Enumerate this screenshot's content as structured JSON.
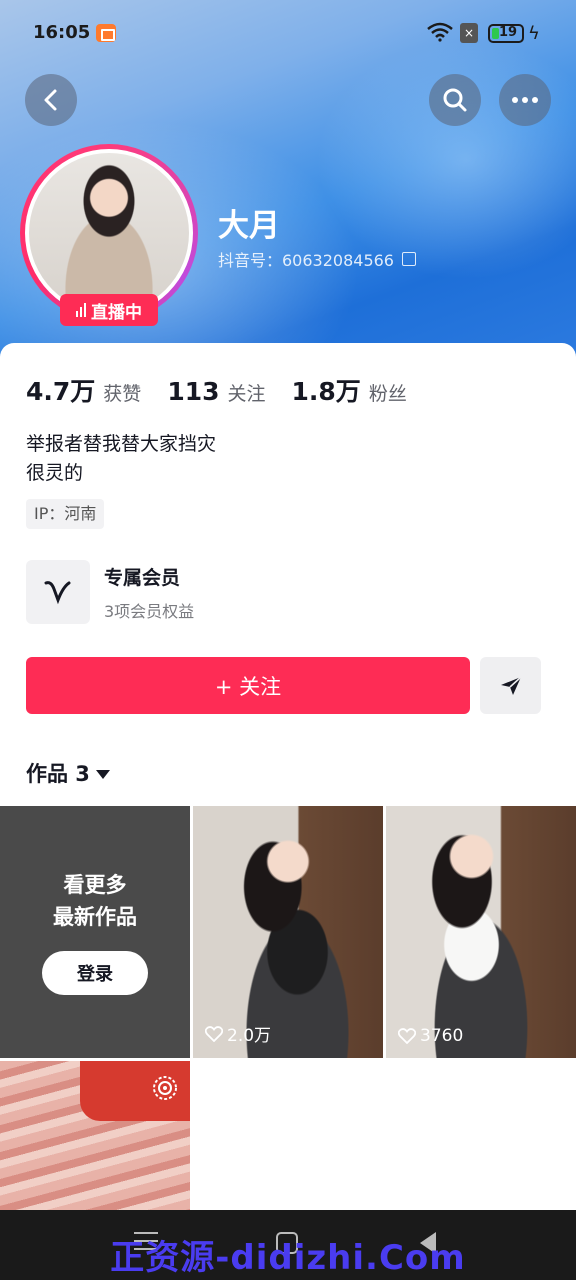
{
  "status_bar": {
    "time": "16:05",
    "battery": "19"
  },
  "profile": {
    "name": "大月",
    "douyin_id": "抖音号：60632084566",
    "live_badge": "直播中"
  },
  "stats": [
    {
      "value": "4.7万",
      "label": "获赞"
    },
    {
      "value": "113",
      "label": "关注"
    },
    {
      "value": "1.8万",
      "label": "粉丝"
    }
  ],
  "bio": {
    "line1": "举报者替我替大家挡灾",
    "line2": "很灵的"
  },
  "ip": "IP：河南",
  "membership": {
    "title": "专属会员",
    "subtitle": "3项会员权益"
  },
  "actions": {
    "follow_label": "+ 关注"
  },
  "works": {
    "tab_label": "作品 3",
    "login_tile": {
      "line1": "看更多",
      "line2": "最新作品",
      "button": "登录"
    },
    "items": [
      {
        "likes": "2.0万"
      },
      {
        "likes": "3760"
      }
    ]
  },
  "watermark": "正资源-didizhi.Com",
  "colors": {
    "accent": "#fe2c55",
    "cover_blue": "#3d8fe6"
  }
}
